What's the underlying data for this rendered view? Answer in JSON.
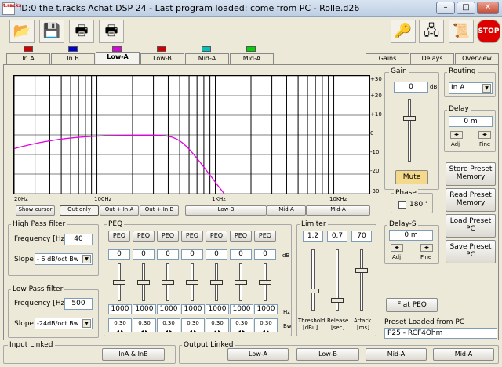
{
  "window": {
    "title": "ID:0 the t.racks Achat DSP 24 - Last program loaded: come from PC - Rolle.d26",
    "app_icon_text": "t.racks"
  },
  "toolbar": {
    "icons": [
      "open-folder-icon",
      "save-disk-icon",
      "print-icon",
      "print-preview-icon",
      "key-icon",
      "network-connect-icon",
      "notes-icon",
      "stop-icon"
    ],
    "stop_label": "STOP"
  },
  "tabs": {
    "left": [
      {
        "label": "In A",
        "led": "#d40000"
      },
      {
        "label": "In B",
        "led": "#0000d4"
      },
      {
        "label": "Low-A",
        "led": "#e000e0",
        "active": true
      },
      {
        "label": "Low-B",
        "led": "#d40000"
      },
      {
        "label": "Mid-A",
        "led": "#00c0c0"
      },
      {
        "label": "Mid-A",
        "led": "#00d400"
      }
    ],
    "right": [
      "Gains",
      "Delays",
      "Overview"
    ]
  },
  "graph": {
    "y_ticks": [
      "+30",
      "+20",
      "+10",
      "0",
      "-10",
      "-20",
      "-30"
    ],
    "x_ticks": [
      "20Hz",
      "100Hz",
      "1KHz",
      "10KHz"
    ],
    "curve_color": "#e000e0"
  },
  "graph_buttons": [
    "Show cursor",
    "Out only",
    "Out + In A",
    "Out + In B",
    "Low-B",
    "Mid-A",
    "Mid-A"
  ],
  "high_pass": {
    "title": "High Pass filter",
    "freq_label": "Frequency [Hz]",
    "freq_value": "40",
    "slope_label": "Slope",
    "slope_value": "- 6 dB/oct Bw"
  },
  "low_pass": {
    "title": "Low Pass filter",
    "freq_label": "Frequency [Hz]",
    "freq_value": "500",
    "slope_label": "Slope",
    "slope_value": "-24dB/oct Bw"
  },
  "peq": {
    "title": "PEQ",
    "band_label": "PEQ",
    "gains": [
      "0",
      "0",
      "0",
      "0",
      "0",
      "0",
      "0"
    ],
    "gain_unit": "dB",
    "freqs": [
      "1000",
      "1000",
      "1000",
      "1000",
      "1000",
      "1000",
      "1000"
    ],
    "freq_unit": "Hz",
    "bws": [
      "0,30",
      "0,30",
      "0,30",
      "0,30",
      "0,30",
      "0,30",
      "0,30"
    ],
    "bw_unit": "Bw"
  },
  "limiter": {
    "title": "Limiter",
    "threshold": "1,2",
    "release": "0.7",
    "attack": "70",
    "threshold_label": "Threshold",
    "threshold_unit": "[dBu]",
    "release_label": "Release",
    "release_unit": "[sec]",
    "attack_label": "Attack",
    "attack_unit": "[ms]"
  },
  "gain": {
    "title": "Gain",
    "value": "0",
    "unit": "dB",
    "mute_label": "Mute"
  },
  "phase": {
    "title": "Phase",
    "value": "180 '"
  },
  "delay_s": {
    "title": "Delay-S",
    "value": "0 m",
    "adj_label": "Adj",
    "fine_label": "Fine"
  },
  "flat_peq_label": "Flat PEQ",
  "routing": {
    "title": "Routing",
    "value": "In A"
  },
  "delay": {
    "title": "Delay",
    "value": "0 m",
    "adj_label": "Adj",
    "fine_label": "Fine"
  },
  "preset_buttons": [
    "Store Preset Memory",
    "Read Preset Memory",
    "Load Preset PC",
    "Save Preset PC"
  ],
  "preset_loaded": {
    "label": "Preset Loaded from PC",
    "value": "P25 - RCF4Ohm"
  },
  "input_linked": {
    "title": "Input Linked",
    "button": "InA & InB"
  },
  "output_linked": {
    "title": "Output Linked",
    "buttons": [
      "Low-A",
      "Low-B",
      "Mid-A",
      "Mid-A"
    ]
  }
}
